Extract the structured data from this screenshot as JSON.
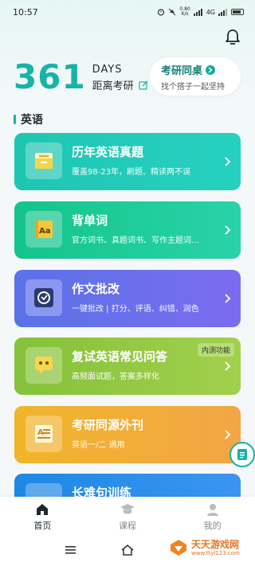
{
  "status": {
    "time": "10:57",
    "net_speed": "0.80",
    "net_unit": "K/s",
    "signal": "4G",
    "battery": ""
  },
  "countdown": {
    "days": "361",
    "days_label": "DAYS",
    "sub_label": "距离考研"
  },
  "desk": {
    "title": "考研同桌",
    "subtitle": "找个搭子一起坚持"
  },
  "section": {
    "title": "英语"
  },
  "cards": [
    {
      "title": "历年英语真题",
      "subtitle": "覆盖98-23年，刷题、精读两不误",
      "color": "#1ec6b2",
      "icon": "exam-book-icon"
    },
    {
      "title": "背单词",
      "subtitle": "官方词书、真题词书、写作主题词…",
      "color": "#14c48a",
      "icon": "vocabulary-book-icon"
    },
    {
      "title": "作文批改",
      "subtitle": "一键批改 | 打分、评语、纠错、润色",
      "color": "#5a72e8",
      "icon": "essay-correction-icon"
    },
    {
      "title": "复试英语常见问答",
      "subtitle": "高频面试题，答案多样化",
      "badge": "内测功能",
      "color": "#85c13a",
      "icon": "interview-chat-icon"
    },
    {
      "title": "考研同源外刊",
      "subtitle": "英语一/二 通用",
      "color": "#f0b52a",
      "icon": "journal-icon"
    },
    {
      "title": "长难句训练",
      "subtitle": "",
      "color": "#1c88e6",
      "icon": "sentence-icon"
    }
  ],
  "tabs": [
    {
      "label": "首页",
      "icon": "home-icon",
      "active": true
    },
    {
      "label": "课程",
      "icon": "graduation-cap-icon",
      "active": false
    },
    {
      "label": "我的",
      "icon": "user-icon",
      "active": false
    }
  ],
  "watermark": {
    "title": "天天游戏网",
    "url": "www.ttyl123.com"
  }
}
